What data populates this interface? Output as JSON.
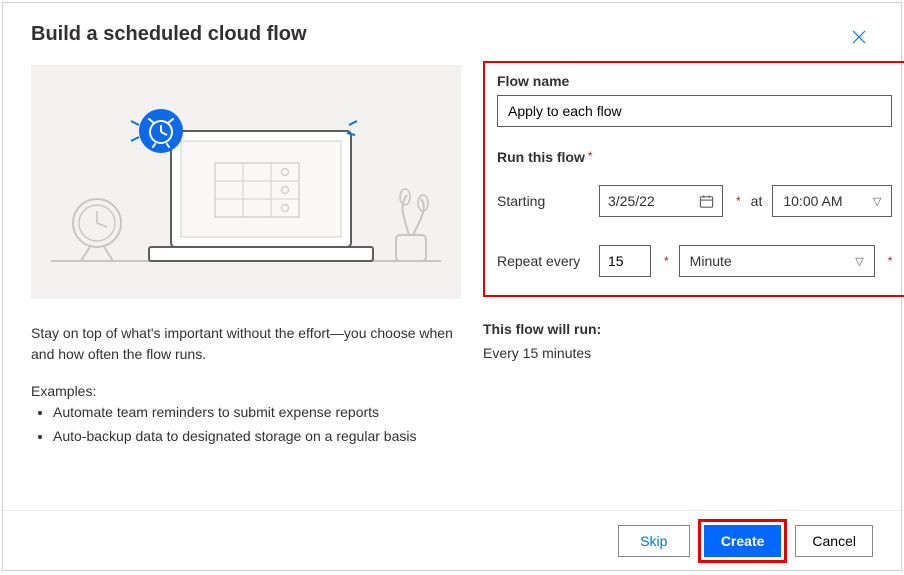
{
  "dialog": {
    "title": "Build a scheduled cloud flow"
  },
  "left": {
    "description": "Stay on top of what's important without the effort—you choose when and how often the flow runs.",
    "examples_label": "Examples:",
    "examples": [
      "Automate team reminders to submit expense reports",
      "Auto-backup data to designated storage on a regular basis"
    ]
  },
  "form": {
    "flow_name_label": "Flow name",
    "flow_name_value": "Apply to each flow",
    "run_section_label": "Run this flow",
    "starting_label": "Starting",
    "start_date": "3/25/22",
    "at_label": "at",
    "start_time": "10:00 AM",
    "repeat_label": "Repeat every",
    "repeat_value": "15",
    "repeat_unit": "Minute",
    "summary_label": "This flow will run:",
    "summary_text": "Every 15 minutes"
  },
  "footer": {
    "skip": "Skip",
    "create": "Create",
    "cancel": "Cancel"
  }
}
